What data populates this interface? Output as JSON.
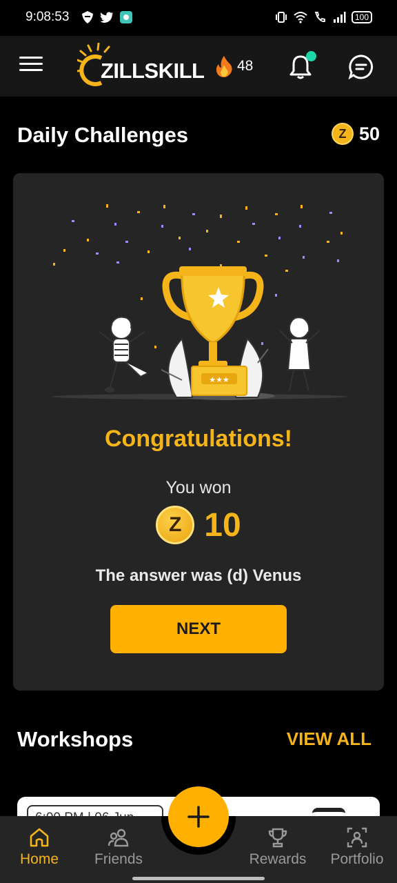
{
  "status_bar": {
    "time": "9:08:53",
    "battery": "100"
  },
  "app_bar": {
    "logo_text": "ZILLSKILL",
    "streak_count": "48",
    "accent_color": "#f5b51a",
    "notification_dot_color": "#1ed6a8"
  },
  "daily_challenges": {
    "title": "Daily Challenges",
    "coin_balance": "50",
    "coin_letter": "Z"
  },
  "result_card": {
    "heading": "Congratulations!",
    "you_won_label": "You won",
    "won_amount": "10",
    "coin_letter": "Z",
    "answer_text": "The answer was (d) Venus",
    "next_label": "NEXT"
  },
  "workshops": {
    "title": "Workshops",
    "view_all_label": "VIEW ALL",
    "first_card_chip": "6:00 PM | 06 Jun"
  },
  "bottom_nav": {
    "items": [
      {
        "label": "Home",
        "icon": "home-icon"
      },
      {
        "label": "Friends",
        "icon": "friends-icon"
      },
      {
        "label": "Rewards",
        "icon": "trophy-icon"
      },
      {
        "label": "Portfolio",
        "icon": "portfolio-icon"
      }
    ],
    "fab_icon": "plus-icon"
  }
}
